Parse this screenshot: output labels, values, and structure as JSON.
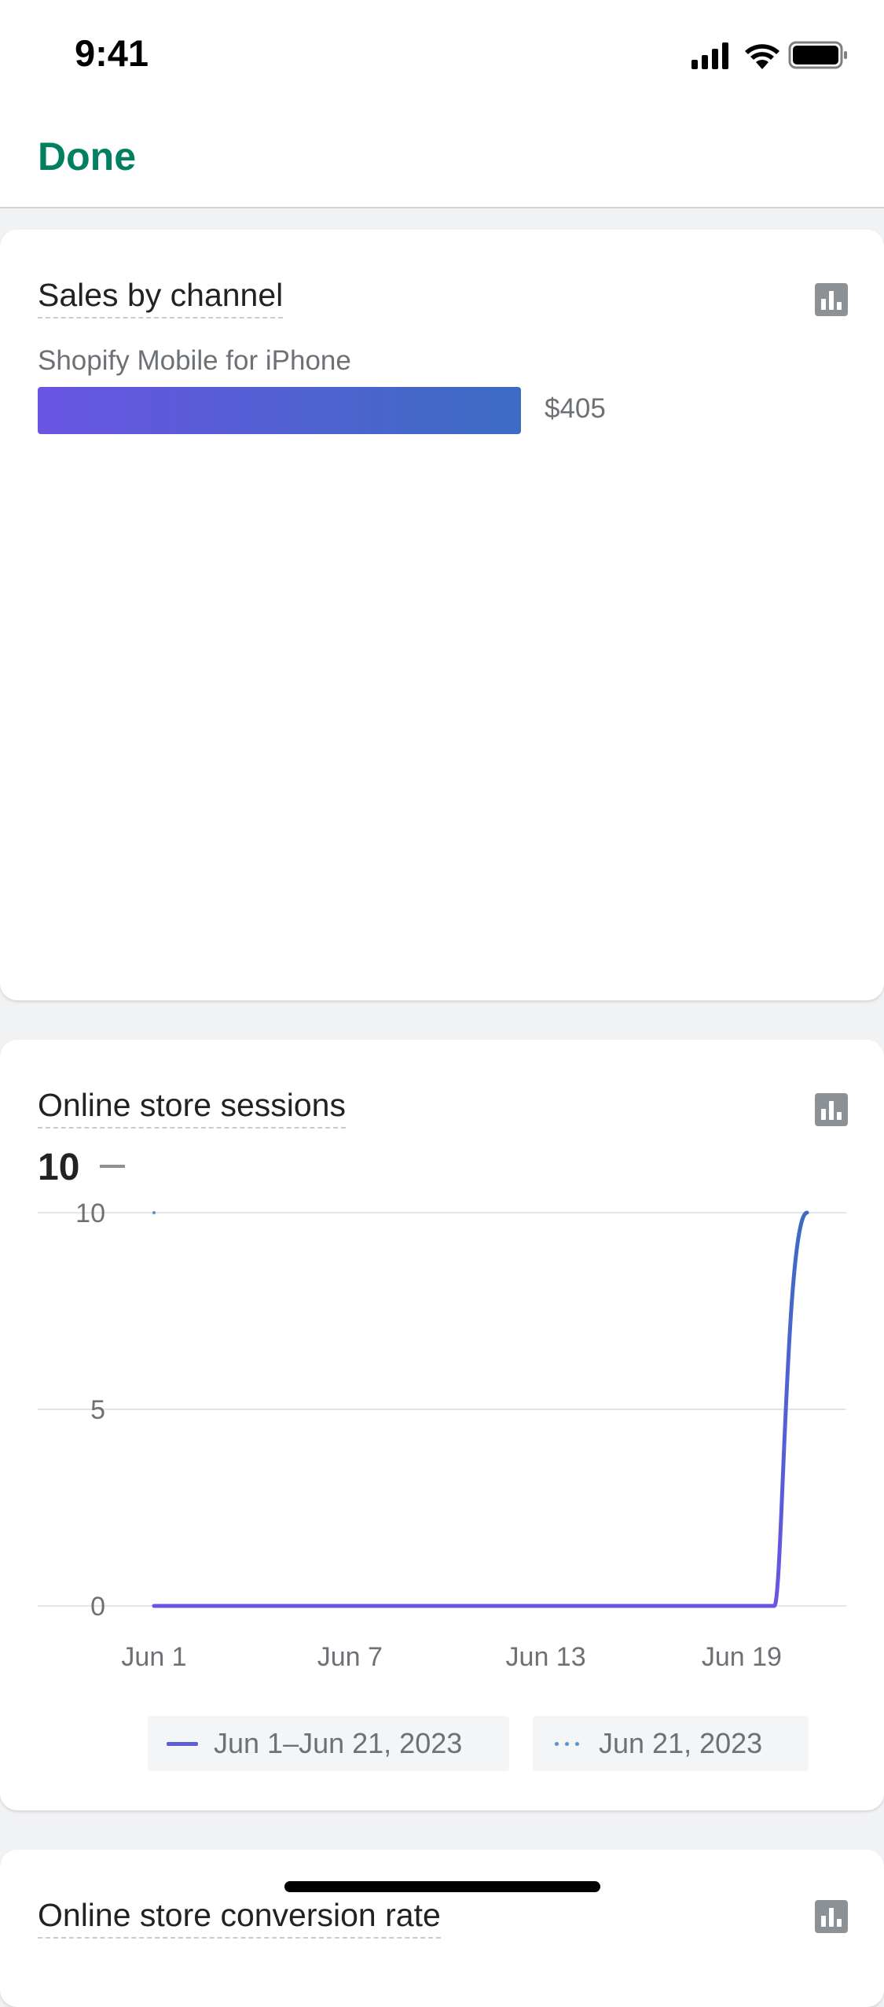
{
  "status_bar": {
    "time": "9:41"
  },
  "nav": {
    "done_label": "Done"
  },
  "sales_card": {
    "title": "Sales by channel",
    "channel": "Shopify Mobile for iPhone",
    "value": "$405"
  },
  "sessions_card": {
    "title": "Online store sessions",
    "metric": "10",
    "chart_data": {
      "type": "line",
      "ylim": [
        0,
        10
      ],
      "y_ticks": [
        "10",
        "5",
        "0"
      ],
      "x_tick_labels": [
        "Jun 1",
        "Jun 7",
        "Jun 13",
        "Jun 19"
      ],
      "x_tick_days": [
        1,
        7,
        13,
        19
      ],
      "series": [
        {
          "name": "Jun 1–Jun 21, 2023",
          "style": "solid",
          "x": [
            1,
            2,
            3,
            4,
            5,
            6,
            7,
            8,
            9,
            10,
            11,
            12,
            13,
            14,
            15,
            16,
            17,
            18,
            19,
            20,
            21
          ],
          "y": [
            0,
            0,
            0,
            0,
            0,
            0,
            0,
            0,
            0,
            0,
            0,
            0,
            0,
            0,
            0,
            0,
            0,
            0,
            0,
            0,
            10
          ]
        },
        {
          "name": "Jun 21, 2023",
          "style": "dotted",
          "x": [
            1
          ],
          "y": [
            10
          ]
        }
      ],
      "colors": {
        "primary": "#6a55e3",
        "secondary": "#3b6cc3"
      }
    }
  },
  "conversion_card": {
    "title": "Online store conversion rate"
  }
}
